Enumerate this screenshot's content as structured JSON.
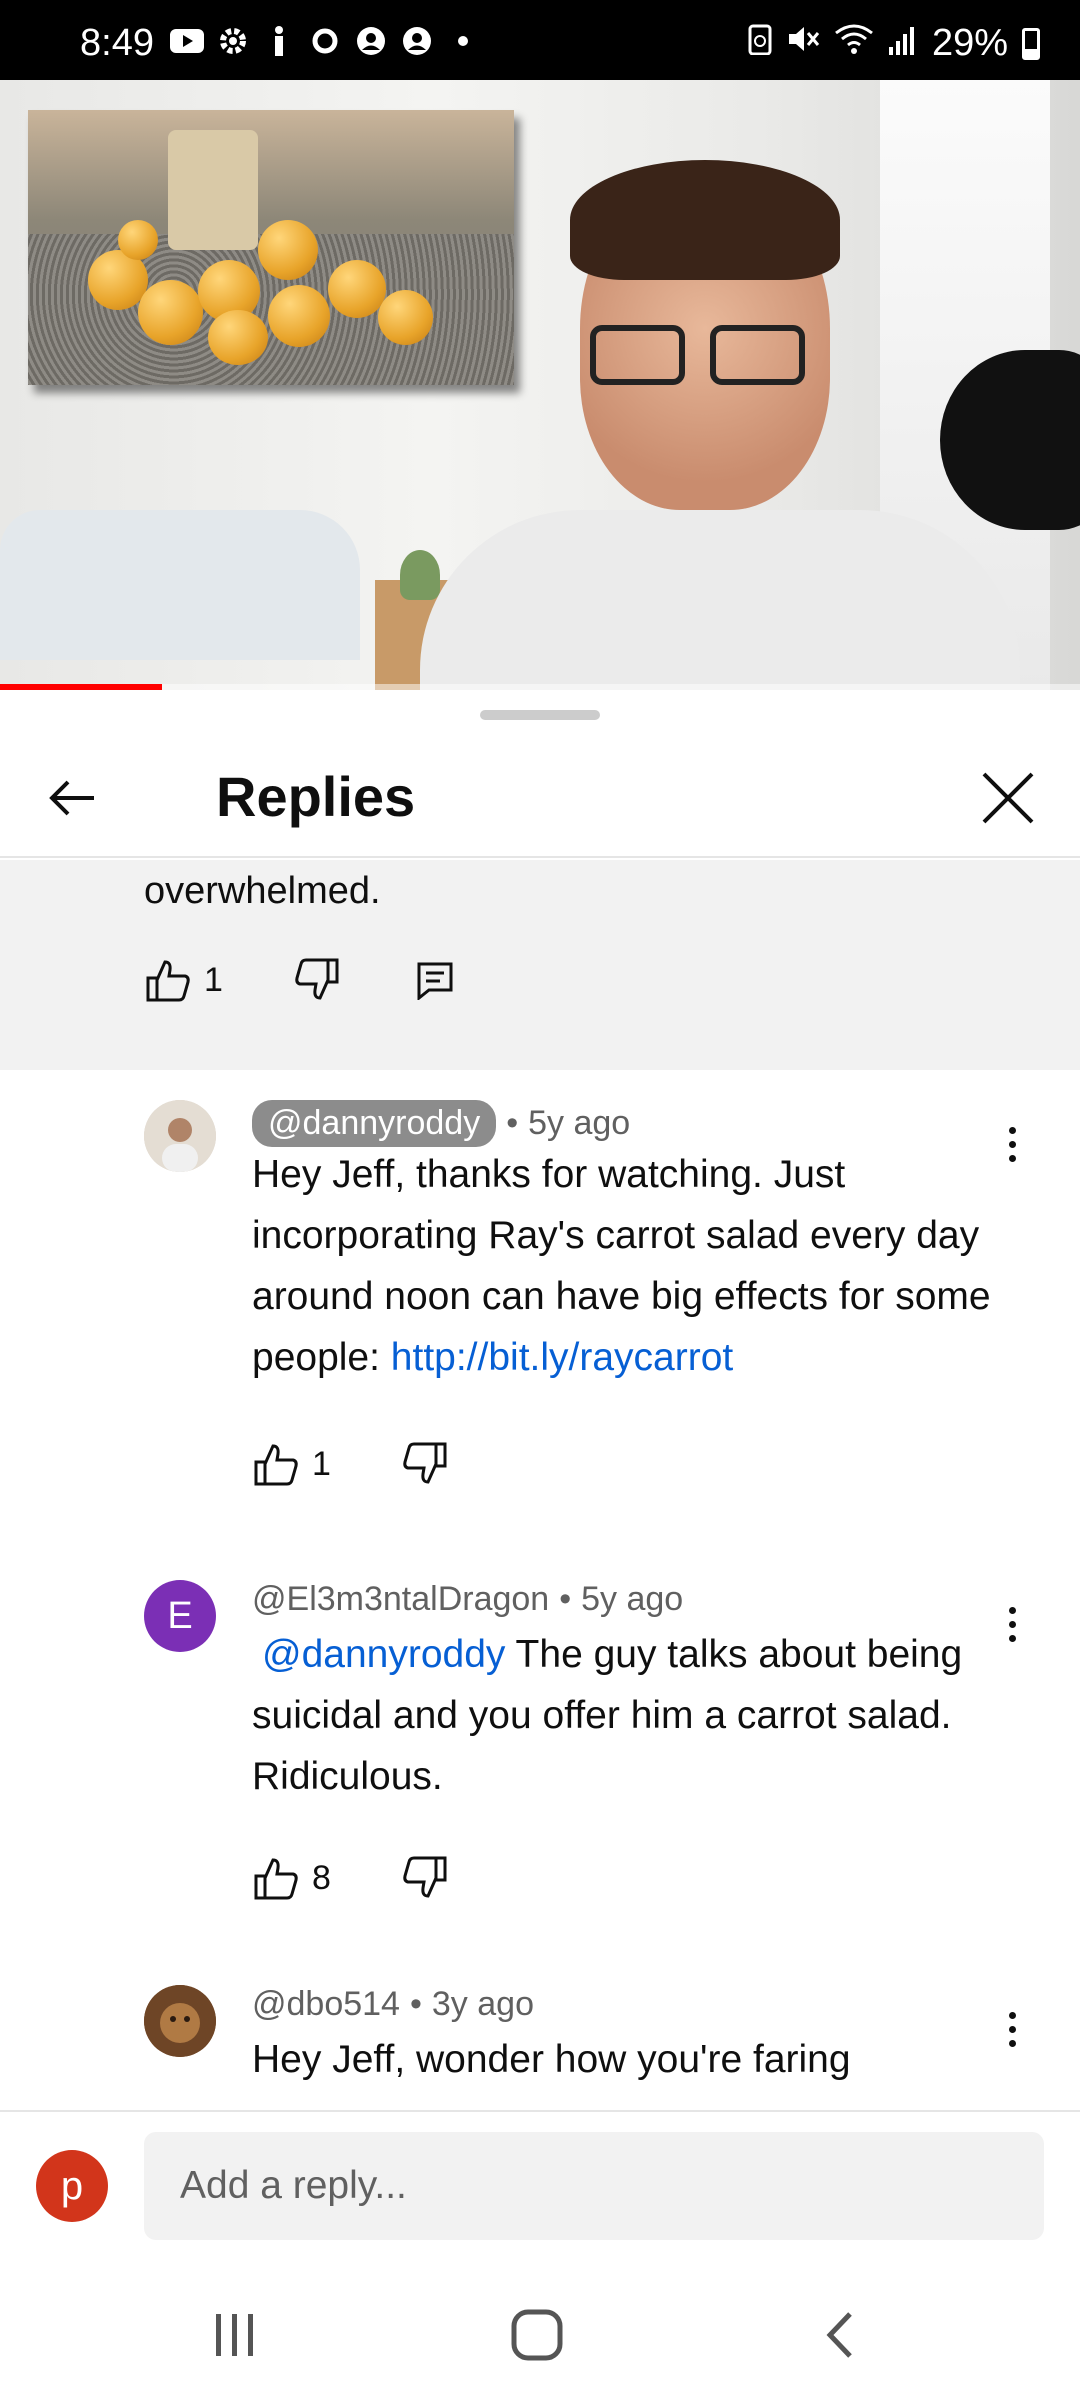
{
  "status_bar": {
    "time": "8:49",
    "battery": "29%",
    "left_icons": [
      "youtube-notification-icon",
      "settings-icon",
      "accessibility-icon",
      "sync-icon",
      "account-icon",
      "account-icon",
      "dot-icon"
    ],
    "right_icons": [
      "battery-saver-icon",
      "mute-icon",
      "wifi-icon",
      "signal-icon"
    ]
  },
  "video": {
    "progress_fraction": 0.15,
    "progress_color": "#ff0000"
  },
  "sheet": {
    "title": "Replies"
  },
  "parent_comment": {
    "text_tail": "overwhelmed.",
    "likes": "1"
  },
  "replies": [
    {
      "author": "@dannyroddy",
      "author_is_creator": true,
      "age": "5y ago",
      "text": "Hey Jeff, thanks for watching. Just incorporating Ray's carrot salad every day around noon can have big effects for some people: ",
      "link": "http://bit.ly/raycarrot",
      "likes": "1"
    },
    {
      "author": "@El3m3ntalDragon",
      "age": "5y ago",
      "avatar_letter": "E",
      "avatar_color": "#7b2fb5",
      "mention": "@dannyroddy",
      "text": " The guy talks about being suicidal and you offer him a carrot salad. Ridiculous.",
      "likes": "8"
    },
    {
      "author": "@dbo514",
      "age": "3y ago",
      "text": "Hey Jeff, wonder how you're faring"
    }
  ],
  "reply_bar": {
    "avatar_letter": "p",
    "avatar_color": "#d2351b",
    "placeholder": "Add a reply..."
  },
  "separator": "•"
}
